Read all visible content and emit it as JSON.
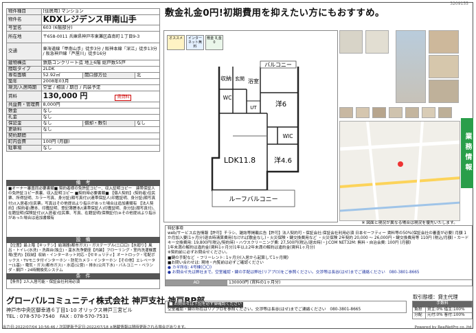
{
  "serial": "3209155",
  "headline": "敷金礼金0円!初期費用を抑えたい方にもおすすめ。",
  "spec": [
    {
      "k": "物件種目",
      "v": "[住居用] マンション"
    },
    {
      "k": "物件名",
      "v": "KDXレジデンス甲南山手"
    },
    {
      "k": "号室名",
      "v": "603 (6階部分)"
    },
    {
      "k": "所在地",
      "v": "〒658-0011 兵庫県神戸市東灘区森南町１丁目9-3"
    },
    {
      "k": "交通",
      "v": "東海道線「甲南山手」徒歩3分 / 阪神本線「深江」徒歩13分 / 阪急神戸線「芦屋川」徒歩16分"
    },
    {
      "k": "建物構造",
      "v": "鉄筋コンクリート造 地上6階 総戸数55戸"
    },
    {
      "k": "間取タイプ",
      "v": "2LDK"
    },
    {
      "k": "専有面積",
      "v": "52.92㎡"
    },
    {
      "k": "築年",
      "v": "2008年03月"
    },
    {
      "k": "現況/入居時期",
      "v": "空室 / 相談 / 期日 / 内装予定"
    },
    {
      "k": "賃料",
      "v": "130,000 円"
    },
    {
      "k": "共益費・管理費",
      "v": "8,000円"
    },
    {
      "k": "敷金",
      "v": "なし"
    },
    {
      "k": "礼金",
      "v": "なし"
    },
    {
      "k": "保証金",
      "v": "なし"
    },
    {
      "k": "更新料",
      "v": "なし"
    },
    {
      "k": "契約期間",
      "v": ""
    },
    {
      "k": "町内会費",
      "v": "100円 (月額)"
    },
    {
      "k": "駐車場",
      "v": "なし"
    }
  ],
  "spec_extra": {
    "direction_label": "開口部方位",
    "direction": "北",
    "shokyaku_label": "償却・敷引",
    "shokyaku": "なし",
    "badge": "賃貸料"
  },
  "sections": {
    "biko_title": "備　考",
    "biko": "■オーナー審査同必要書類■ 契約者様の免許証コピー、収入証明コピー　連帯保証人の免許証コピー表裏、収入証明コピー ■契約時必要書類■ 【個人契約】(契約者)住民票、所得証明、カラー写真、身分証(顔写真付)/(連帯保証人)印鑑証明、身分証(顔写真付)/(入居者)住民票。写真はその他提出より指示があった場合は追加書類有 【法人契約】(契約者)謄本、印鑑証明、登記簿謄本/(連帯保証人)印鑑証明、身分証(顔写真付)、在籍証明(保険証付)/(入居者)住民票、写真、在籍証明(保険証付)※その他提出より指示があった場合は追加書類有",
    "setsubi_title": "設　備",
    "setsubi": "【位置】最上階【キッチン】給湯器(都市ガス)・ガステーブル(二口口)【水廻り】風呂・トイレ(水洗)・洗面台(独立)・温水洗浄便座【内装】フローリング・室内洗濯機置場(室内)【収納】収納・インターネット対応・【セキュリティ】オートロック・宅配ボックス・TVモニタ付インターホン・防犯カメラ・インターホン【その他】エレベーター(1基)・電気・ガス(都市ガス)・水道(公営)・排水(公共下水)・バルコニー・ベランダ・網戸・24時間換気システム",
    "joken_title": "条　件",
    "joken": "【条件】2人入居可能・保証会社利用必須"
  },
  "remarks": {
    "title": "特記事項",
    "line1": "web/サービス広告情報【許可】チラシ、雑誌等掲載広告【許可】法人契約可・保証会社:保証会社利用必須 日本セーフティー 賃料等の50%(保証会社の審査が必要) 月額 1か月加入要(1ヶ月分)退去時清算費用(なければ敷金なし)・火災保険・鍵交換費用など ・火災保険 2年契約 20,000 ～ 26,000円・鍵交換費用等 110円 (税込/月額)・カードキー交換費用: 19,800円(税込/契約時)・ハウスクリーニング費: 27,500円(税込/退去時)・J:COM NET32M: 無料・自治会費: 100円 (月額)",
    "line2": "1年未満の解約は違約金(賃料1ヶ月分)1年以上2年未満の解約は違約金(賃料1ヶ月分)",
    "line3": "※契約前に必ずお問合せください。",
    "line4": "■鍵の手配など ・フリーレント: 1ヶ月分(入居から起算して1ヶ月間)",
    "line5": "■お問い合わせは: 現地・内覧前は必ずご確認ください",
    "bullet1": "● カギ所在: 4号棟(〇〇)",
    "bullet2": "● お問合せ先は弊社まで。空室確認・鍵の手配は弊社(リアプロ)をご参照ください。交渉等は長谷(はせ)までご連絡ください　080-3801-8665"
  },
  "ad": {
    "label": "AD",
    "value": "130000円 (賃料の1ヶ月分)"
  },
  "floornote": "※ 図面と現況が異なる場合は現況を優先いたします。",
  "floorplan": {
    "balcony": "バルコニー",
    "roof_balcony": "ルーフバルコニー",
    "shuno": "収納",
    "genkan": "玄関",
    "wc": "WC",
    "yoku": "浴室",
    "ut": "UT",
    "yo6": "洋6",
    "wic": "WIC",
    "ldk": "LDK11.8",
    "yo46": "洋4.6"
  },
  "badges": [
    "オススメ",
    "インターネット無料",
    "敷金 礼金 0"
  ],
  "greentab": "業務情報",
  "company": {
    "name": "グローバルコミュニティ株式会社 神戸支社 神戸BP部",
    "address": "神戸市中央区御幸通６丁目1-10 オリックス神戸三宮ビル",
    "tel": "TEL : 078-570-7540　FAX : 078-570-7531"
  },
  "torihiki": {
    "title": "取引態様：貸主代理",
    "head": "手数料",
    "rows": [
      {
        "k": "負担",
        "v": "貸主:0% 借主:100%"
      },
      {
        "k": "分配",
        "v": "元付:0% 客付:100%"
      }
    ]
  },
  "bottombox": {
    "l1": "■ お問合せは下記を必ず御確認ください",
    "l2": "空室確認・鍵の所在はリアプロを参照ください。交渉等は長谷(はせ)までご連絡ください　080-3801-8665"
  },
  "footer": "出力日:2022/07/04 10:56:46 / 次回更新予定日:2022/07/18 ※掲載情報は随時更新される場合があります。",
  "footer2": "Powered by RealNetPro co.,ltd."
}
